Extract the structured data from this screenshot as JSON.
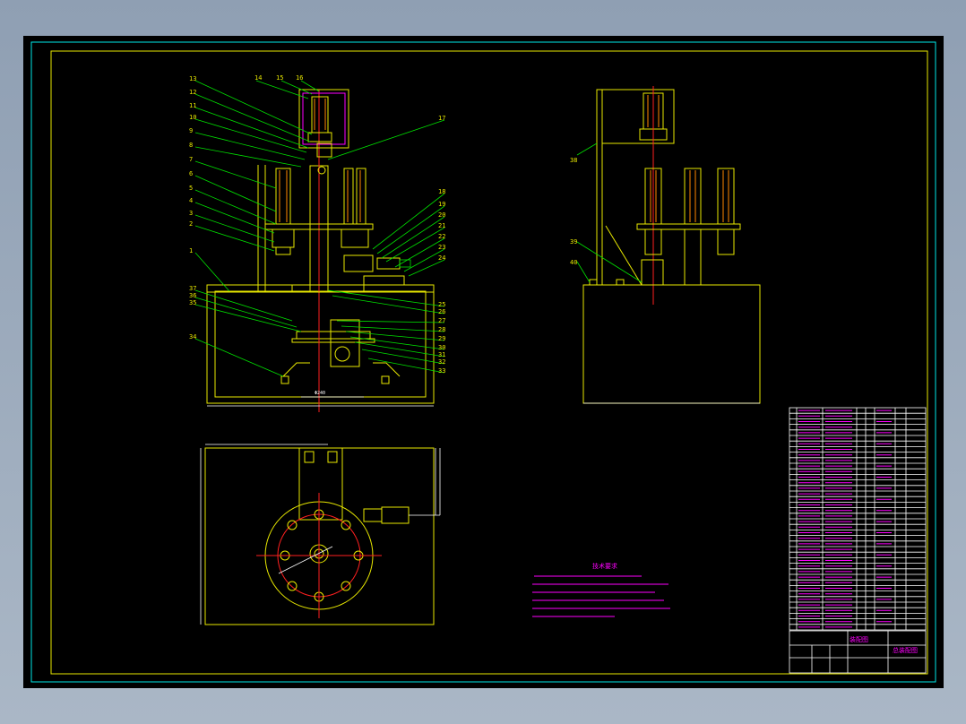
{
  "drawing": {
    "front_view_labels": [
      "13",
      "12",
      "11",
      "10",
      "9",
      "8",
      "7",
      "6",
      "5",
      "4",
      "3",
      "2",
      "1",
      "37",
      "36",
      "35",
      "34"
    ],
    "top_labels": [
      "14",
      "15",
      "16"
    ],
    "right_labels": [
      "17",
      "18",
      "19",
      "20",
      "21",
      "22",
      "23",
      "24",
      "25",
      "26",
      "27",
      "28",
      "29",
      "30",
      "31",
      "32",
      "33"
    ],
    "side_view_labels": [
      "38",
      "39",
      "40"
    ],
    "tech_req_title": "技术要求",
    "title_block": {
      "name": "装配图",
      "drawing_no": "总装配图"
    },
    "colors": {
      "frame": "#00e8e8",
      "outline": "#e8e800",
      "leader": "#00e000",
      "center": "#ff2020",
      "notes": "#ff00ff"
    }
  }
}
